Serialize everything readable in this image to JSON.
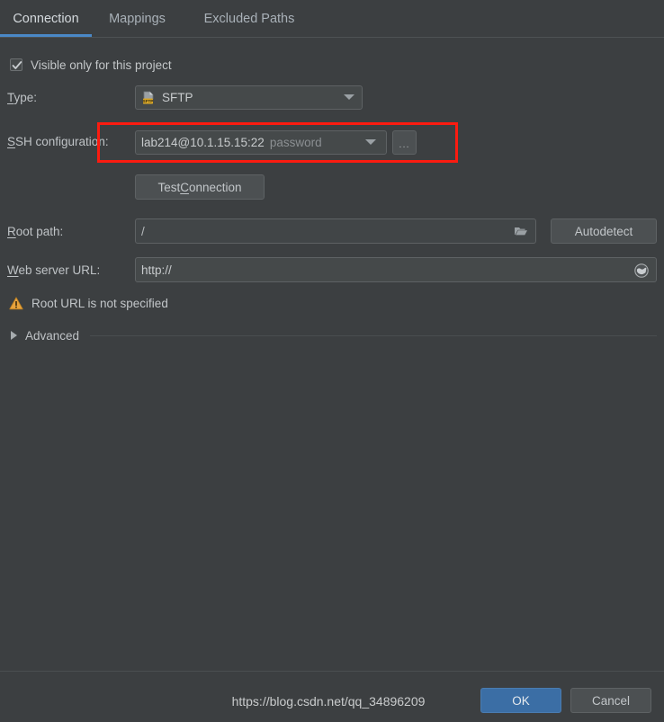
{
  "tabs": [
    {
      "id": "connection",
      "label": "Connection",
      "active": true
    },
    {
      "id": "mappings",
      "label": "Mappings",
      "active": false
    },
    {
      "id": "excluded-paths",
      "label": "Excluded Paths",
      "active": false
    }
  ],
  "visibility": {
    "checkbox_label": "Visible only for this project",
    "checked": true
  },
  "type_row": {
    "label": "Type:",
    "mnemonic": "T",
    "label_rest": "ype:",
    "value": "SFTP",
    "icon": "sftp-file-icon",
    "icon_badge": "SFTP"
  },
  "ssh_row": {
    "label_mnemonic": "S",
    "label_rest": "SH configuration:",
    "value": "lab214@10.1.15.15:22",
    "auth_hint": "password",
    "ellipsis_button": "...",
    "highlight_color": "#fb1b10"
  },
  "test_connection": {
    "label_before": "Test ",
    "mnemonic": "C",
    "label_after": "onnection"
  },
  "root_path_row": {
    "label_mnemonic": "R",
    "label_rest": "oot path:",
    "value": "/",
    "icon": "folder-icon",
    "autodetect_label": "Autodetect"
  },
  "web_server_url_row": {
    "label_mnemonic": "W",
    "label_rest": "eb server URL:",
    "value": "http://",
    "icon": "globe-icon"
  },
  "warning": {
    "icon": "warning-triangle-icon",
    "text": "Root URL is not specified",
    "color": "#e8a33d"
  },
  "advanced": {
    "label": "Advanced",
    "expanded": false
  },
  "footer": {
    "ok_label": "OK",
    "cancel_label": "Cancel",
    "ok_color": "#3b6ea5"
  },
  "watermark": {
    "text": "https://blog.csdn.net/qq_34896209"
  }
}
